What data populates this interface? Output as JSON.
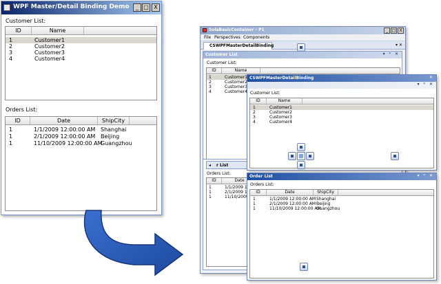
{
  "left_window": {
    "title": "WPF Master/Detail Binding Demo",
    "controls": [
      "_",
      "□",
      "X"
    ],
    "customer_label": "Customer List:",
    "customer_columns": [
      "ID",
      "Name"
    ],
    "customers": [
      {
        "id": "1",
        "name": "Customer1"
      },
      {
        "id": "2",
        "name": "Customer2"
      },
      {
        "id": "3",
        "name": "Customer3"
      },
      {
        "id": "4",
        "name": "Customer4"
      }
    ],
    "orders_label": "Orders List:",
    "order_columns": [
      "ID",
      "Date",
      "ShipCity"
    ],
    "orders": [
      {
        "id": "1",
        "date": "1/1/2009 12:00:00 AM",
        "city": "Shanghai"
      },
      {
        "id": "1",
        "date": "2/1/2009 12:00:00 AM",
        "city": "Beijing"
      },
      {
        "id": "1",
        "date": "11/10/2009 12:00:00 AM",
        "city": "Guangzhou"
      }
    ]
  },
  "right_window": {
    "title": "SolaBasicContainer - P1",
    "controls": [
      "_",
      "□",
      "X"
    ],
    "menu": [
      "File",
      "Perspectives",
      "Components"
    ],
    "doc_tab": "CSWPFMasterDetailBinding",
    "tab_controls": "▾ ✕",
    "customer_pane_title": "Customer List",
    "customer_label": "Customer List:",
    "orders_label": "Orders List:",
    "order_tab_partial": "r List",
    "floating_title": "CSWPFMasterDetailBinding",
    "float_customer_label": "Customer List:",
    "order_pane_title": "Order List",
    "pane_controls": "▾ ᵖ ✕",
    "float_controls": "✕",
    "columns_customer": [
      "ID",
      "Name"
    ],
    "columns_order": [
      "ID",
      "Date",
      "ShipCity"
    ]
  },
  "colors": {
    "title_active": "#0a246a",
    "title_fade": "#a6caf0",
    "selection": "#d9d6cf",
    "arrow": "#2a5ab8"
  }
}
